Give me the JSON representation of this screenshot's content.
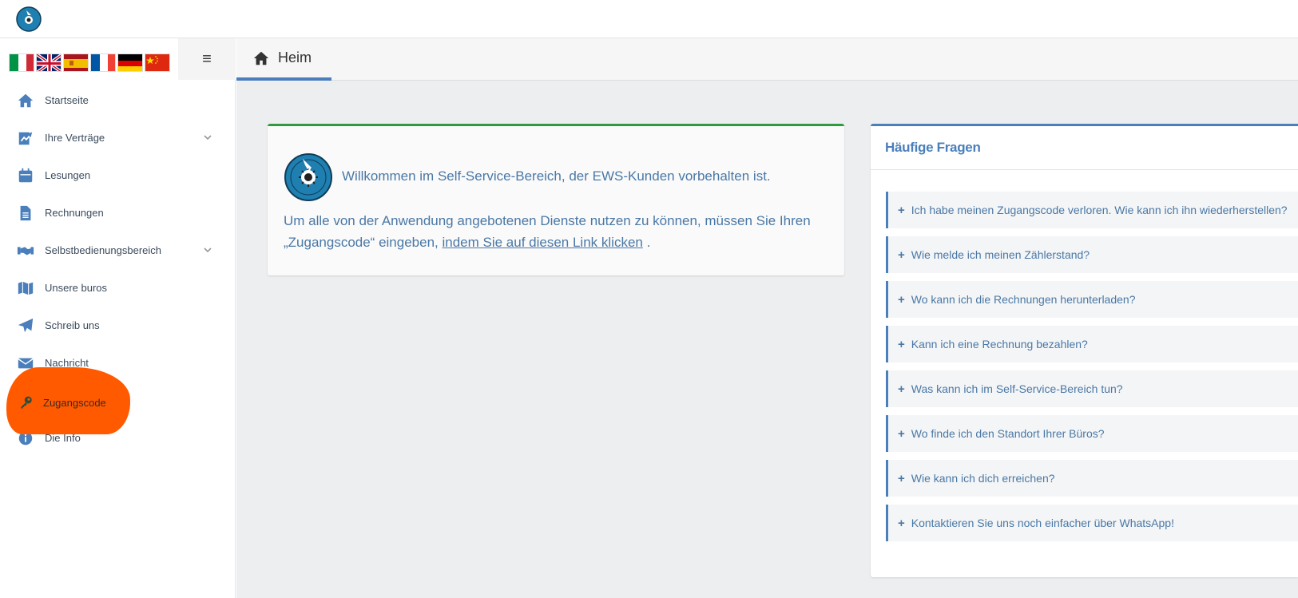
{
  "header": {
    "logo_icon": "ews-logo-icon"
  },
  "languages": [
    {
      "name": "flag-italy-icon"
    },
    {
      "name": "flag-uk-icon"
    },
    {
      "name": "flag-spain-icon"
    },
    {
      "name": "flag-france-icon"
    },
    {
      "name": "flag-germany-icon"
    },
    {
      "name": "flag-china-icon"
    }
  ],
  "sidebar": {
    "toggle_label": "≡",
    "items": [
      {
        "label": "Startseite",
        "icon": "home-icon"
      },
      {
        "label": "Ihre Verträge",
        "icon": "contract-icon",
        "expandable": true
      },
      {
        "label": "Lesungen",
        "icon": "calendar-icon"
      },
      {
        "label": "Rechnungen",
        "icon": "document-icon"
      },
      {
        "label": "Selbstbedienungsbereich",
        "icon": "handshake-icon",
        "expandable": true
      },
      {
        "label": "Unsere buros",
        "icon": "map-icon"
      },
      {
        "label": "Schreib uns",
        "icon": "paper-plane-icon"
      },
      {
        "label": "Nachricht",
        "icon": "envelope-icon"
      },
      {
        "label": "Zugangscode",
        "icon": "key-icon"
      },
      {
        "label": "Die Info",
        "icon": "info-icon"
      }
    ]
  },
  "tabs": [
    {
      "label": "Heim",
      "icon": "home-icon",
      "active": true
    }
  ],
  "welcome": {
    "title": "Willkommen im Self-Service-Bereich, der EWS-Kunden vorbehalten ist.",
    "body_before": "Um alle von der Anwendung angebotenen Dienste nutzen zu können, müssen Sie Ihren „Zugangscode“ eingeben,",
    "link_text": "indem Sie auf diesen Link klicken",
    "body_after": " .",
    "accent_color": "#2e9c3e"
  },
  "faq": {
    "title": "Häufige Fragen",
    "accent_color": "#4a7fbb",
    "items": [
      "Ich habe meinen Zugangscode verloren. Wie kann ich ihn wiederherstellen?",
      "Wie melde ich meinen Zählerstand?",
      "Wo kann ich die Rechnungen herunterladen?",
      "Kann ich eine Rechnung bezahlen?",
      "Was kann ich im Self-Service-Bereich tun?",
      "Wo finde ich den Standort Ihrer Büros?",
      "Wie kann ich dich erreichen?",
      "Kontaktieren Sie uns noch einfacher über WhatsApp!"
    ]
  },
  "annotation": {
    "color": "#ff5a00",
    "marks": "Zugangscode"
  }
}
